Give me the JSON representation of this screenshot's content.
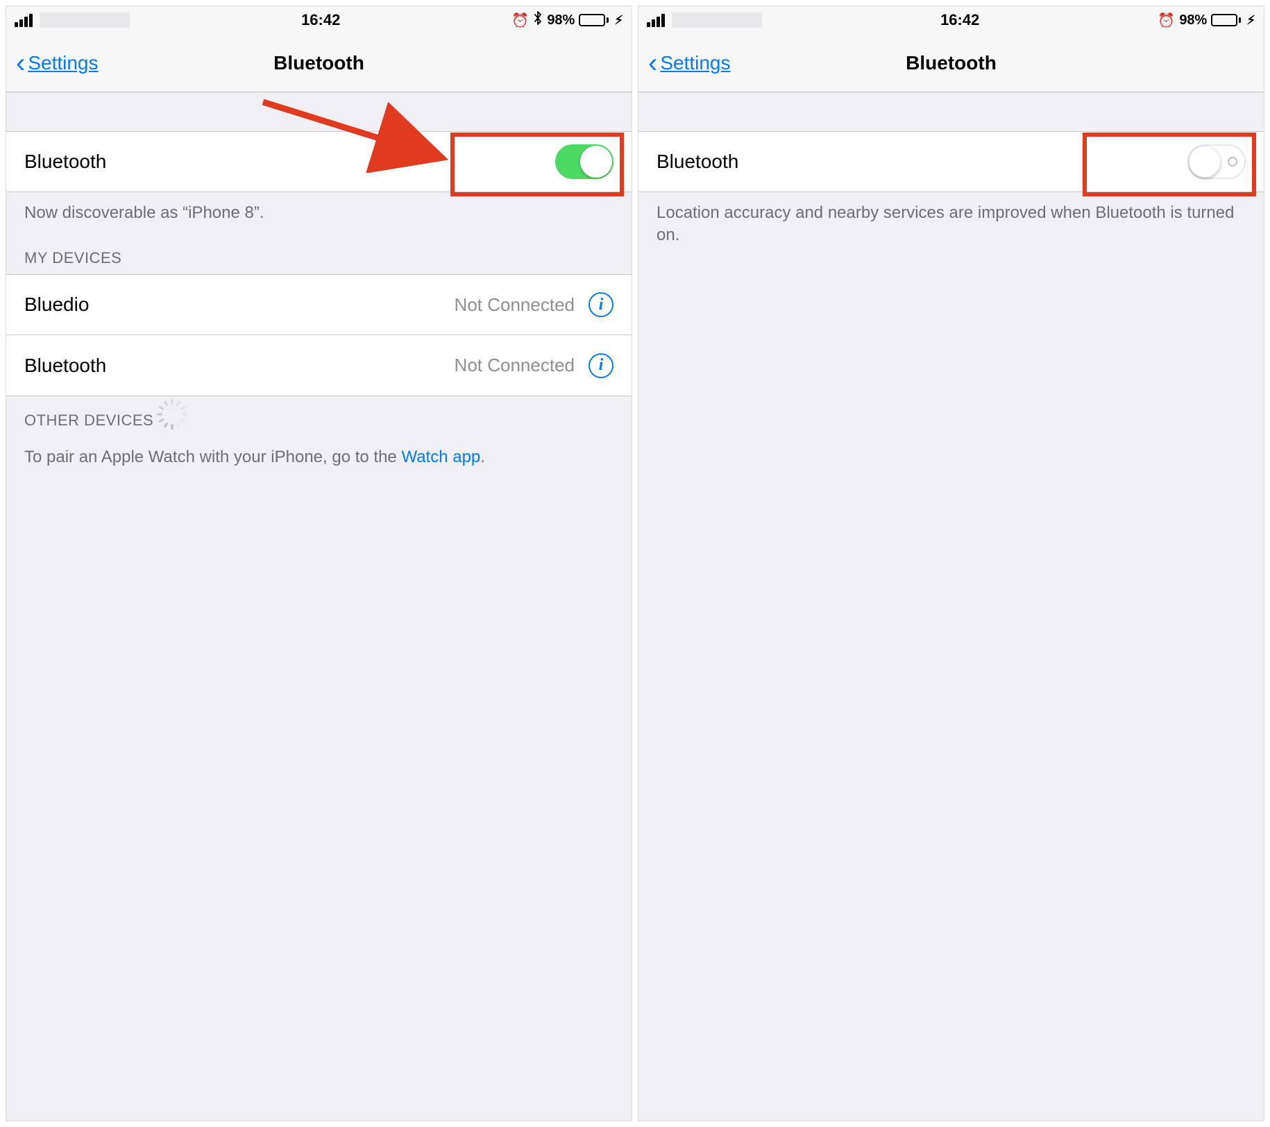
{
  "screens": [
    {
      "status": {
        "time": "16:42",
        "battery_pct": "98%",
        "show_bt_icon": true
      },
      "nav": {
        "back": "Settings",
        "title": "Bluetooth"
      },
      "toggle_row": {
        "label": "Bluetooth",
        "on": true
      },
      "discoverable_text": "Now discoverable as “iPhone 8”.",
      "my_devices_header": "MY DEVICES",
      "devices": [
        {
          "name": "Bluedio",
          "status": "Not Connected"
        },
        {
          "name": "Bluetooth",
          "status": "Not Connected"
        }
      ],
      "other_devices_header": "OTHER DEVICES",
      "pair_text_prefix": "To pair an Apple Watch with your iPhone, go to the ",
      "pair_link": "Watch app",
      "pair_text_suffix": "."
    },
    {
      "status": {
        "time": "16:42",
        "battery_pct": "98%",
        "show_bt_icon": false
      },
      "nav": {
        "back": "Settings",
        "title": "Bluetooth"
      },
      "toggle_row": {
        "label": "Bluetooth",
        "on": false
      },
      "off_text": "Location accuracy and nearby services are improved when Bluetooth is turned on."
    }
  ]
}
